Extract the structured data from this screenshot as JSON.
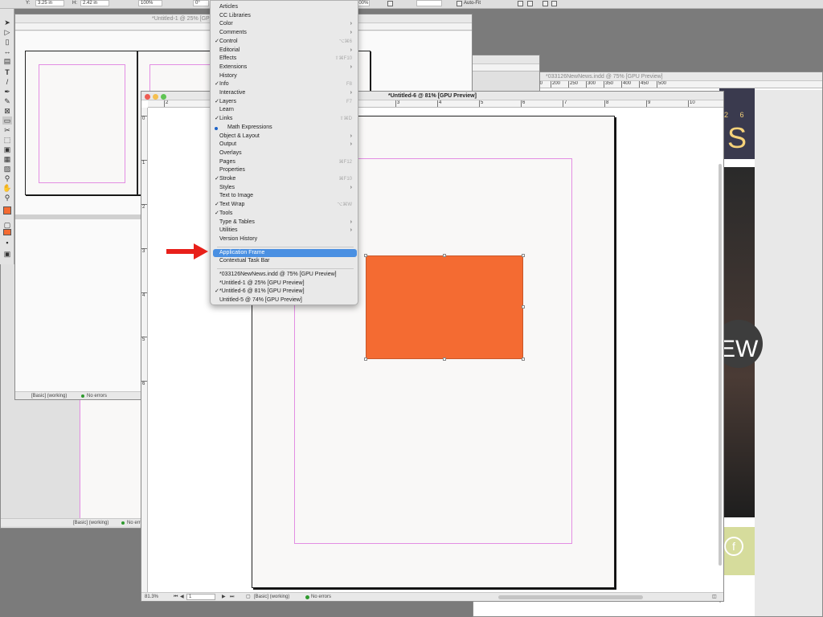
{
  "control_bar": {
    "y_label": "Y:",
    "y_value": "3.25 in",
    "h_label": "H:",
    "h_value": "2.42 in",
    "scale_value": "100%",
    "angle_value": "0°",
    "scale2_value": "100%",
    "autofit_label": "Auto-Fit"
  },
  "menu": {
    "items": [
      {
        "label": "Articles",
        "checked": false,
        "shortcut": "",
        "submenu": false
      },
      {
        "label": "CC Libraries",
        "checked": false,
        "shortcut": "",
        "submenu": false
      },
      {
        "label": "Color",
        "checked": false,
        "shortcut": "",
        "submenu": true
      },
      {
        "label": "Comments",
        "checked": false,
        "shortcut": "",
        "submenu": true
      },
      {
        "label": "Control",
        "checked": true,
        "shortcut": "⌥⌘6",
        "submenu": false
      },
      {
        "label": "Editorial",
        "checked": false,
        "shortcut": "",
        "submenu": true
      },
      {
        "label": "Effects",
        "checked": false,
        "shortcut": "⇧⌘F10",
        "submenu": false
      },
      {
        "label": "Extensions",
        "checked": false,
        "shortcut": "",
        "submenu": true
      },
      {
        "label": "History",
        "checked": false,
        "shortcut": "",
        "submenu": false
      },
      {
        "label": "Info",
        "checked": true,
        "shortcut": "F8",
        "submenu": false
      },
      {
        "label": "Interactive",
        "checked": false,
        "shortcut": "",
        "submenu": true
      },
      {
        "label": "Layers",
        "checked": true,
        "shortcut": "F7",
        "submenu": false
      },
      {
        "label": "Learn",
        "checked": false,
        "shortcut": "",
        "submenu": false
      },
      {
        "label": "Links",
        "checked": true,
        "shortcut": "⇧⌘D",
        "submenu": false
      },
      {
        "label": "Math Expressions",
        "checked": false,
        "dot": true,
        "shortcut": "",
        "submenu": false
      },
      {
        "label": "Object & Layout",
        "checked": false,
        "shortcut": "",
        "submenu": true
      },
      {
        "label": "Output",
        "checked": false,
        "shortcut": "",
        "submenu": true
      },
      {
        "label": "Overlays",
        "checked": false,
        "shortcut": "",
        "submenu": false
      },
      {
        "label": "Pages",
        "checked": false,
        "shortcut": "⌘F12",
        "submenu": false
      },
      {
        "label": "Properties",
        "checked": false,
        "shortcut": "",
        "submenu": false
      },
      {
        "label": "Stroke",
        "checked": true,
        "shortcut": "⌘F10",
        "submenu": false
      },
      {
        "label": "Styles",
        "checked": false,
        "shortcut": "",
        "submenu": true
      },
      {
        "label": "Text to Image",
        "checked": false,
        "shortcut": "",
        "submenu": false
      },
      {
        "label": "Text Wrap",
        "checked": true,
        "shortcut": "⌥⌘W",
        "submenu": false
      },
      {
        "label": "Tools",
        "checked": true,
        "shortcut": "",
        "submenu": false
      },
      {
        "label": "Type & Tables",
        "checked": false,
        "shortcut": "",
        "submenu": true
      },
      {
        "label": "Utilities",
        "checked": false,
        "shortcut": "",
        "submenu": true
      },
      {
        "label": "Version History",
        "checked": false,
        "shortcut": "",
        "submenu": false
      }
    ],
    "app_items": [
      {
        "label": "Application Frame",
        "highlighted": true
      },
      {
        "label": "Contextual Task Bar",
        "highlighted": false
      }
    ],
    "doc_items": [
      {
        "label": "*033126NewNews.indd @ 75% [GPU Preview]",
        "checked": false
      },
      {
        "label": "*Untitled-1 @ 25% [GPU Preview]",
        "checked": false
      },
      {
        "label": "*Untitled-6 @ 81% [GPU Preview]",
        "checked": true
      },
      {
        "label": "Untitled-5 @ 74% [GPU Preview]",
        "checked": false
      }
    ]
  },
  "windows": {
    "untitled1_title": "*Untitled-1 @ 25% [GPU",
    "newnews_title": "*033126NewNews.indd @ 75% [GPU Preview]",
    "main_title": "*Untitled-6 @ 81% [GPU Preview]"
  },
  "status": {
    "zoom": "81.3%",
    "page": "1",
    "preflight_profile": "[Basic] (working)",
    "errors": "No errors",
    "back_profile": "[Basic] (working)",
    "back_errors": "No errors",
    "back2_profile": "[Basic] (working)",
    "back2_errors": "No errors"
  },
  "rulers": {
    "main_h": [
      "2",
      "1",
      "2",
      "3",
      "4",
      "5",
      "6",
      "7",
      "8",
      "9",
      "10"
    ],
    "main_v": [
      "0",
      "1",
      "2",
      "3",
      "4",
      "5",
      "6"
    ],
    "newnews_h": [
      "10",
      "50",
      "100",
      "150",
      "200",
      "250",
      "300",
      "350",
      "400",
      "450",
      "500"
    ]
  },
  "background_text": {
    "partial_digits": "2 6",
    "partial_letter": "S",
    "partial_ew": "EW",
    "partial_f": "f"
  },
  "colors": {
    "orange_frame": "#f46b32",
    "menu_highlight": "#4a90e2",
    "margin_guide": "#e38ee3",
    "arrow": "#e8201a"
  }
}
